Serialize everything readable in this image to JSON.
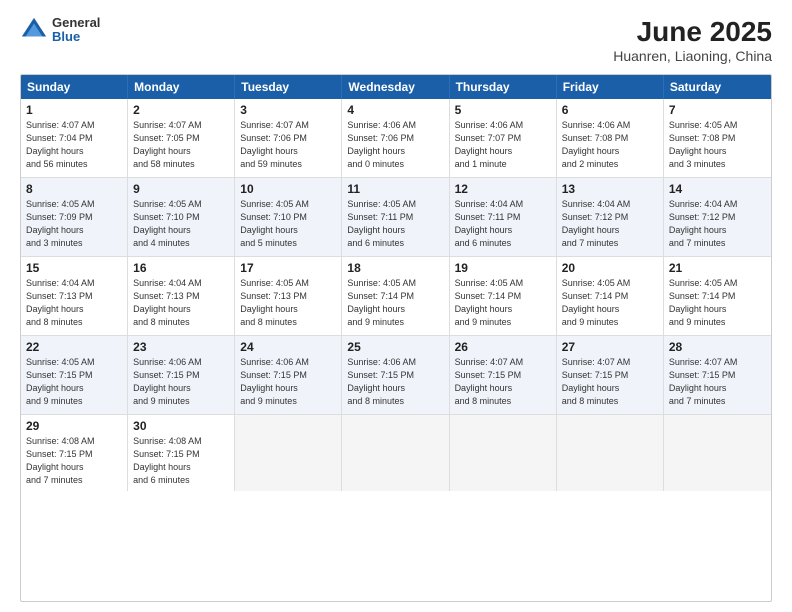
{
  "header": {
    "logo": {
      "general": "General",
      "blue": "Blue"
    },
    "title": "June 2025",
    "subtitle": "Huanren, Liaoning, China"
  },
  "calendar": {
    "days": [
      "Sunday",
      "Monday",
      "Tuesday",
      "Wednesday",
      "Thursday",
      "Friday",
      "Saturday"
    ],
    "rows": [
      [
        {
          "day": "",
          "empty": true
        },
        {
          "day": "2",
          "sunrise": "4:07 AM",
          "sunset": "7:05 PM",
          "daylight": "14 hours and 58 minutes."
        },
        {
          "day": "3",
          "sunrise": "4:07 AM",
          "sunset": "7:06 PM",
          "daylight": "14 hours and 59 minutes."
        },
        {
          "day": "4",
          "sunrise": "4:06 AM",
          "sunset": "7:06 PM",
          "daylight": "15 hours and 0 minutes."
        },
        {
          "day": "5",
          "sunrise": "4:06 AM",
          "sunset": "7:07 PM",
          "daylight": "15 hours and 1 minute."
        },
        {
          "day": "6",
          "sunrise": "4:06 AM",
          "sunset": "7:08 PM",
          "daylight": "15 hours and 2 minutes."
        },
        {
          "day": "7",
          "sunrise": "4:05 AM",
          "sunset": "7:08 PM",
          "daylight": "15 hours and 3 minutes."
        }
      ],
      [
        {
          "day": "1",
          "sunrise": "4:07 AM",
          "sunset": "7:04 PM",
          "daylight": "14 hours and 56 minutes.",
          "first": true
        },
        {
          "day": "",
          "empty": true
        },
        {
          "day": "",
          "empty": true
        },
        {
          "day": "",
          "empty": true
        },
        {
          "day": "",
          "empty": true
        },
        {
          "day": "",
          "empty": true
        },
        {
          "day": "",
          "empty": true
        }
      ],
      [
        {
          "day": "8",
          "sunrise": "4:05 AM",
          "sunset": "7:09 PM",
          "daylight": "15 hours and 3 minutes."
        },
        {
          "day": "9",
          "sunrise": "4:05 AM",
          "sunset": "7:10 PM",
          "daylight": "15 hours and 4 minutes."
        },
        {
          "day": "10",
          "sunrise": "4:05 AM",
          "sunset": "7:10 PM",
          "daylight": "15 hours and 5 minutes."
        },
        {
          "day": "11",
          "sunrise": "4:05 AM",
          "sunset": "7:11 PM",
          "daylight": "15 hours and 6 minutes."
        },
        {
          "day": "12",
          "sunrise": "4:04 AM",
          "sunset": "7:11 PM",
          "daylight": "15 hours and 6 minutes."
        },
        {
          "day": "13",
          "sunrise": "4:04 AM",
          "sunset": "7:12 PM",
          "daylight": "15 hours and 7 minutes."
        },
        {
          "day": "14",
          "sunrise": "4:04 AM",
          "sunset": "7:12 PM",
          "daylight": "15 hours and 7 minutes."
        }
      ],
      [
        {
          "day": "15",
          "sunrise": "4:04 AM",
          "sunset": "7:13 PM",
          "daylight": "15 hours and 8 minutes."
        },
        {
          "day": "16",
          "sunrise": "4:04 AM",
          "sunset": "7:13 PM",
          "daylight": "15 hours and 8 minutes."
        },
        {
          "day": "17",
          "sunrise": "4:05 AM",
          "sunset": "7:13 PM",
          "daylight": "15 hours and 8 minutes."
        },
        {
          "day": "18",
          "sunrise": "4:05 AM",
          "sunset": "7:14 PM",
          "daylight": "15 hours and 9 minutes."
        },
        {
          "day": "19",
          "sunrise": "4:05 AM",
          "sunset": "7:14 PM",
          "daylight": "15 hours and 9 minutes."
        },
        {
          "day": "20",
          "sunrise": "4:05 AM",
          "sunset": "7:14 PM",
          "daylight": "15 hours and 9 minutes."
        },
        {
          "day": "21",
          "sunrise": "4:05 AM",
          "sunset": "7:14 PM",
          "daylight": "15 hours and 9 minutes."
        }
      ],
      [
        {
          "day": "22",
          "sunrise": "4:05 AM",
          "sunset": "7:15 PM",
          "daylight": "15 hours and 9 minutes."
        },
        {
          "day": "23",
          "sunrise": "4:06 AM",
          "sunset": "7:15 PM",
          "daylight": "15 hours and 9 minutes."
        },
        {
          "day": "24",
          "sunrise": "4:06 AM",
          "sunset": "7:15 PM",
          "daylight": "15 hours and 9 minutes."
        },
        {
          "day": "25",
          "sunrise": "4:06 AM",
          "sunset": "7:15 PM",
          "daylight": "15 hours and 8 minutes."
        },
        {
          "day": "26",
          "sunrise": "4:07 AM",
          "sunset": "7:15 PM",
          "daylight": "15 hours and 8 minutes."
        },
        {
          "day": "27",
          "sunrise": "4:07 AM",
          "sunset": "7:15 PM",
          "daylight": "15 hours and 8 minutes."
        },
        {
          "day": "28",
          "sunrise": "4:07 AM",
          "sunset": "7:15 PM",
          "daylight": "15 hours and 7 minutes."
        }
      ],
      [
        {
          "day": "29",
          "sunrise": "4:08 AM",
          "sunset": "7:15 PM",
          "daylight": "15 hours and 7 minutes."
        },
        {
          "day": "30",
          "sunrise": "4:08 AM",
          "sunset": "7:15 PM",
          "daylight": "15 hours and 6 minutes."
        },
        {
          "day": "",
          "empty": true
        },
        {
          "day": "",
          "empty": true
        },
        {
          "day": "",
          "empty": true
        },
        {
          "day": "",
          "empty": true
        },
        {
          "day": "",
          "empty": true
        }
      ]
    ]
  }
}
